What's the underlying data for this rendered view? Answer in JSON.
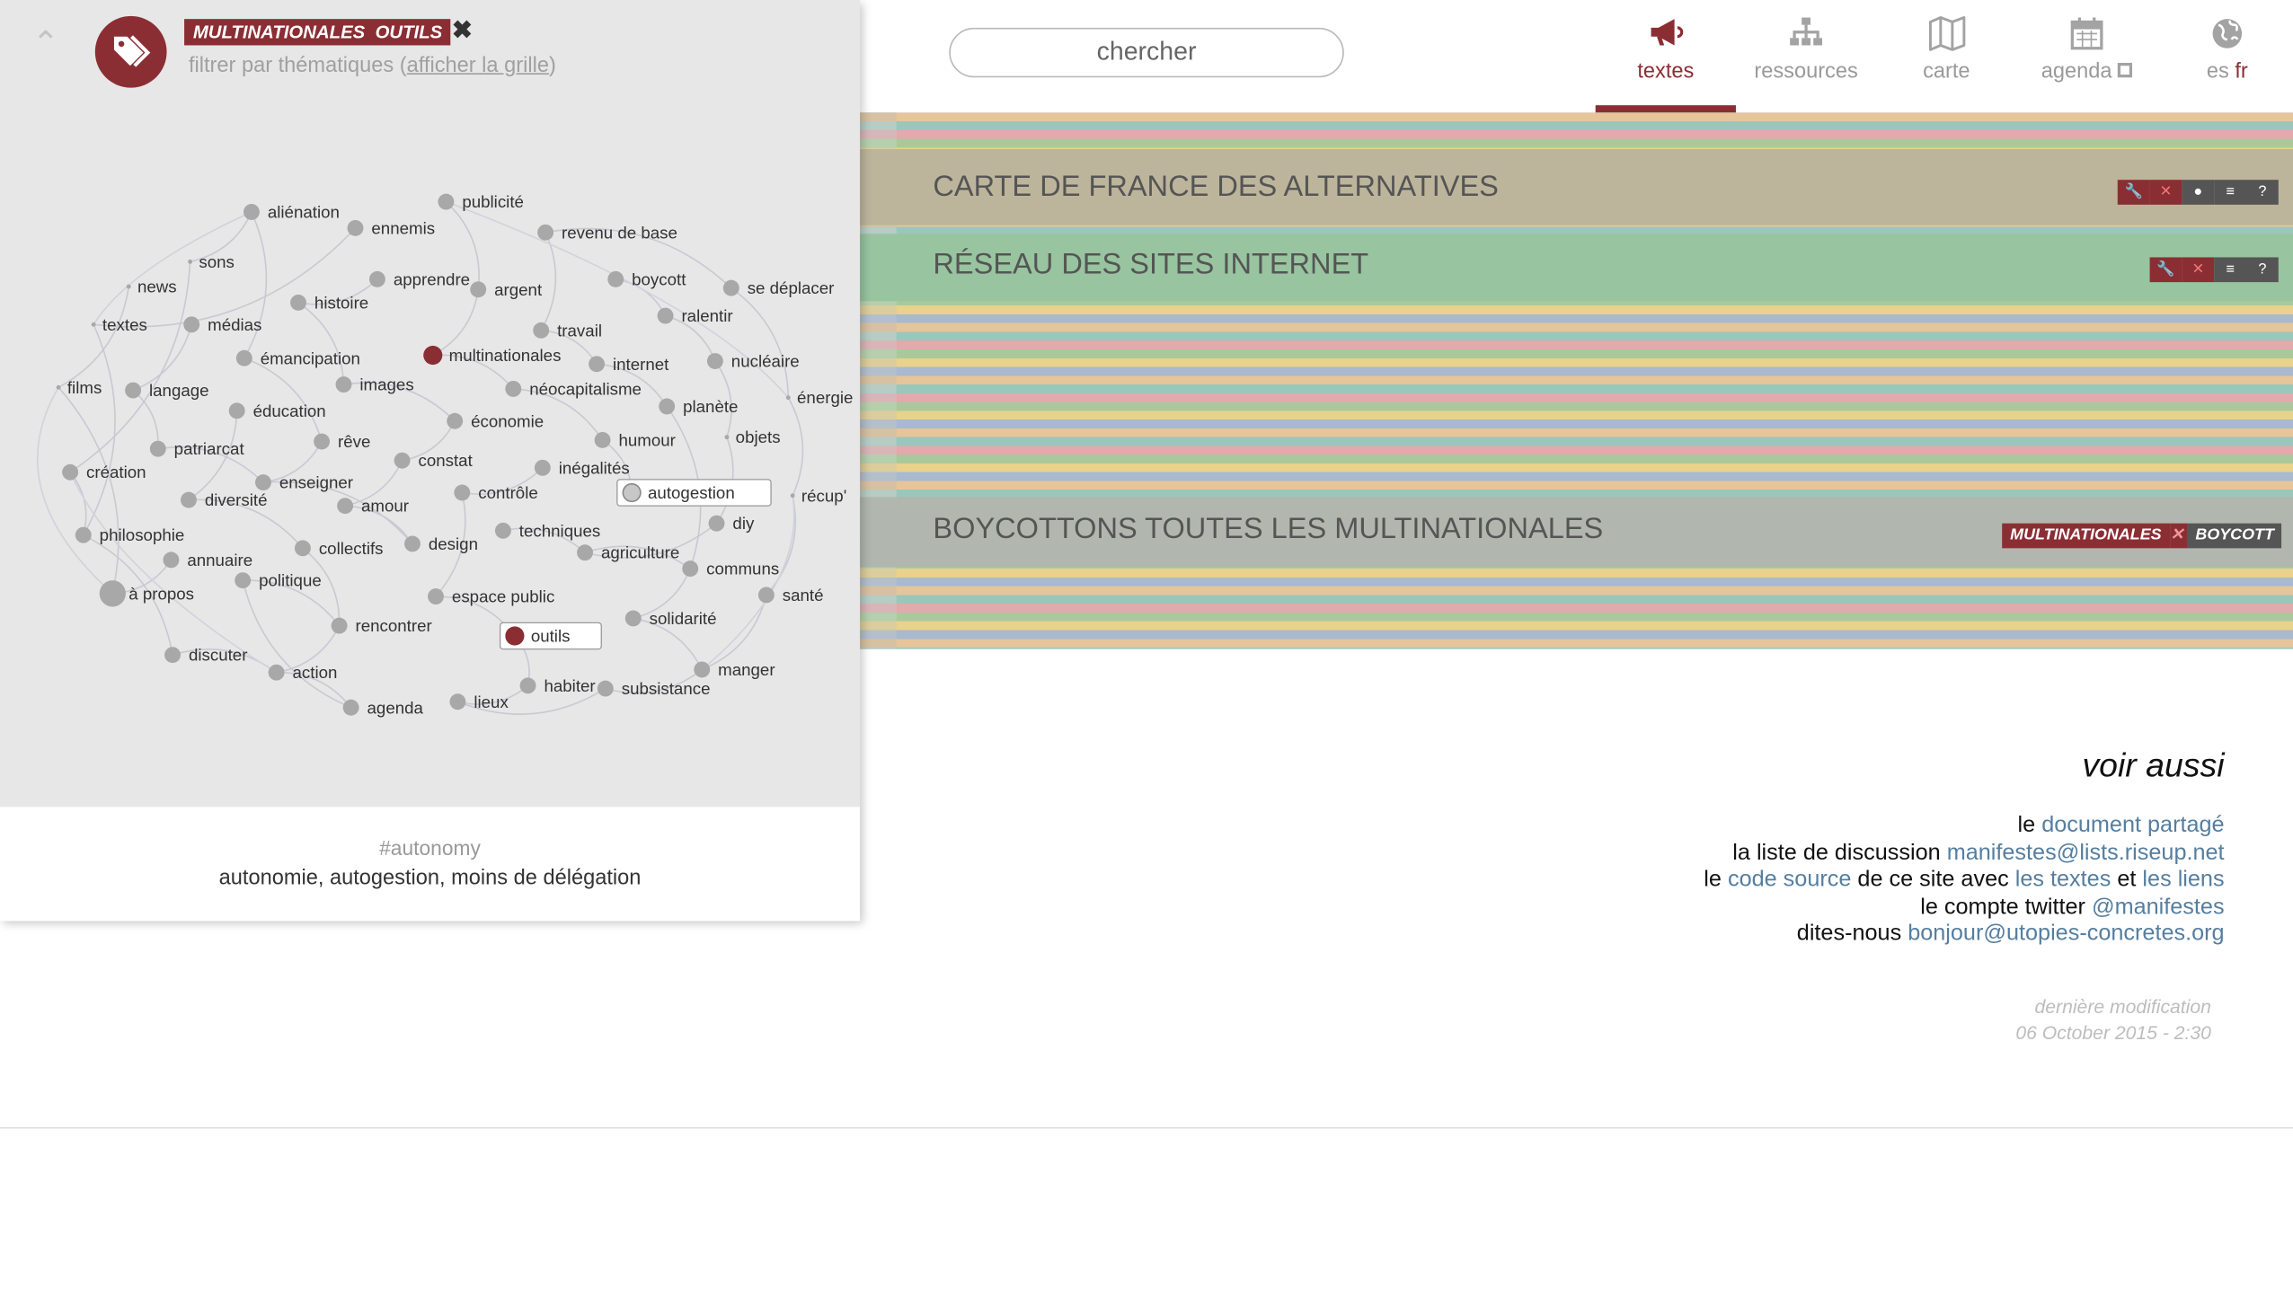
{
  "tag_panel": {
    "collapse_icon": "chevron-up-icon",
    "badge_icon": "tags-icon",
    "active_tags": [
      "MULTINATIONALES",
      "OUTILS"
    ],
    "clear_icon": "close-icon",
    "filter_text": "filtrer par thématiques",
    "grid_link_open": "(",
    "grid_link": "afficher la grille",
    "grid_link_close": ")",
    "footer_hashtag": "#autonomy",
    "footer_description": "autonomie, autogestion, moins de délégation",
    "accent_color": "#8b2e34",
    "tags": [
      {
        "label": "aliénation",
        "state": "normal"
      },
      {
        "label": "ennemis",
        "state": "normal"
      },
      {
        "label": "publicité",
        "state": "normal"
      },
      {
        "label": "revenu de base",
        "state": "normal"
      },
      {
        "label": "sons",
        "state": "normal"
      },
      {
        "label": "news",
        "state": "normal"
      },
      {
        "label": "apprendre",
        "state": "normal"
      },
      {
        "label": "argent",
        "state": "normal"
      },
      {
        "label": "boycott",
        "state": "normal"
      },
      {
        "label": "se déplacer",
        "state": "normal"
      },
      {
        "label": "textes",
        "state": "normal"
      },
      {
        "label": "médias",
        "state": "normal"
      },
      {
        "label": "histoire",
        "state": "normal"
      },
      {
        "label": "travail",
        "state": "normal"
      },
      {
        "label": "ralentir",
        "state": "normal"
      },
      {
        "label": "émancipation",
        "state": "normal"
      },
      {
        "label": "multinationales",
        "state": "active"
      },
      {
        "label": "internet",
        "state": "normal"
      },
      {
        "label": "nucléaire",
        "state": "normal"
      },
      {
        "label": "films",
        "state": "normal"
      },
      {
        "label": "langage",
        "state": "normal"
      },
      {
        "label": "images",
        "state": "normal"
      },
      {
        "label": "néocapitalisme",
        "state": "normal"
      },
      {
        "label": "planète",
        "state": "normal"
      },
      {
        "label": "énergie",
        "state": "normal"
      },
      {
        "label": "éducation",
        "state": "normal"
      },
      {
        "label": "économie",
        "state": "normal"
      },
      {
        "label": "humour",
        "state": "normal"
      },
      {
        "label": "objets",
        "state": "normal"
      },
      {
        "label": "patriarcat",
        "state": "normal"
      },
      {
        "label": "rêve",
        "state": "normal"
      },
      {
        "label": "création",
        "state": "normal"
      },
      {
        "label": "constat",
        "state": "normal"
      },
      {
        "label": "inégalités",
        "state": "normal"
      },
      {
        "label": "enseigner",
        "state": "normal"
      },
      {
        "label": "autogestion",
        "state": "hover"
      },
      {
        "label": "diversité",
        "state": "normal"
      },
      {
        "label": "contrôle",
        "state": "normal"
      },
      {
        "label": "récup'",
        "state": "normal"
      },
      {
        "label": "amour",
        "state": "normal"
      },
      {
        "label": "diy",
        "state": "normal"
      },
      {
        "label": "philosophie",
        "state": "normal"
      },
      {
        "label": "techniques",
        "state": "normal"
      },
      {
        "label": "collectifs",
        "state": "normal"
      },
      {
        "label": "design",
        "state": "normal"
      },
      {
        "label": "agriculture",
        "state": "normal"
      },
      {
        "label": "annuaire",
        "state": "normal"
      },
      {
        "label": "communs",
        "state": "normal"
      },
      {
        "label": "politique",
        "state": "normal"
      },
      {
        "label": "à propos",
        "state": "normal"
      },
      {
        "label": "espace public",
        "state": "normal"
      },
      {
        "label": "santé",
        "state": "normal"
      },
      {
        "label": "solidarité",
        "state": "normal"
      },
      {
        "label": "rencontrer",
        "state": "normal"
      },
      {
        "label": "outils",
        "state": "active"
      },
      {
        "label": "discuter",
        "state": "normal"
      },
      {
        "label": "manger",
        "state": "normal"
      },
      {
        "label": "action",
        "state": "normal"
      },
      {
        "label": "habiter",
        "state": "normal"
      },
      {
        "label": "subsistance",
        "state": "normal"
      },
      {
        "label": "lieux",
        "state": "normal"
      },
      {
        "label": "agenda",
        "state": "normal"
      }
    ]
  },
  "search": {
    "placeholder": "chercher"
  },
  "nav": {
    "tabs": [
      {
        "label": "textes",
        "icon": "megaphone-icon",
        "active": true
      },
      {
        "label": "ressources",
        "icon": "sitemap-icon",
        "active": false
      },
      {
        "label": "carte",
        "icon": "map-icon",
        "active": false
      },
      {
        "label": "agenda",
        "icon": "calendar-icon",
        "active": false,
        "external_icon": "external-link-icon"
      }
    ],
    "lang": {
      "icon": "globe-icon",
      "other": "es",
      "current": "fr"
    }
  },
  "rows": [
    {
      "title": "CARTE DE FRANCE DES ALTERNATIVES",
      "tools": [
        "wrench-icon",
        "close-icon",
        "map-marker-icon",
        "database-icon",
        "question-icon"
      ]
    },
    {
      "title": "RÉSEAU DES SITES INTERNET",
      "tools": [
        "wrench-icon",
        "close-icon",
        "database-icon",
        "question-icon"
      ]
    },
    {
      "title": "BOYCOTTONS TOUTES LES MULTINATIONALES",
      "tags": [
        "MULTINATIONALES",
        "BOYCOTT"
      ]
    }
  ],
  "see_also": {
    "title": "voir aussi",
    "l1_pre": "le",
    "l1_link": "document partagé",
    "l2_pre": "la liste de discussion",
    "l2_link": "manifestes@lists.riseup.net",
    "l3_pre": "le",
    "l3_link1": "code source",
    "l3_mid": "de ce site avec",
    "l3_link2": "les textes",
    "l3_and": "et",
    "l3_link3": "les liens",
    "l4_pre": "le compte twitter",
    "l4_link": "@manifestes",
    "l5_pre": "dites-nous",
    "l5_link": "bonjour@utopies-concretes.org"
  },
  "modified": {
    "label": "dernière modification",
    "date": "06 October 2015 - 2:30"
  }
}
